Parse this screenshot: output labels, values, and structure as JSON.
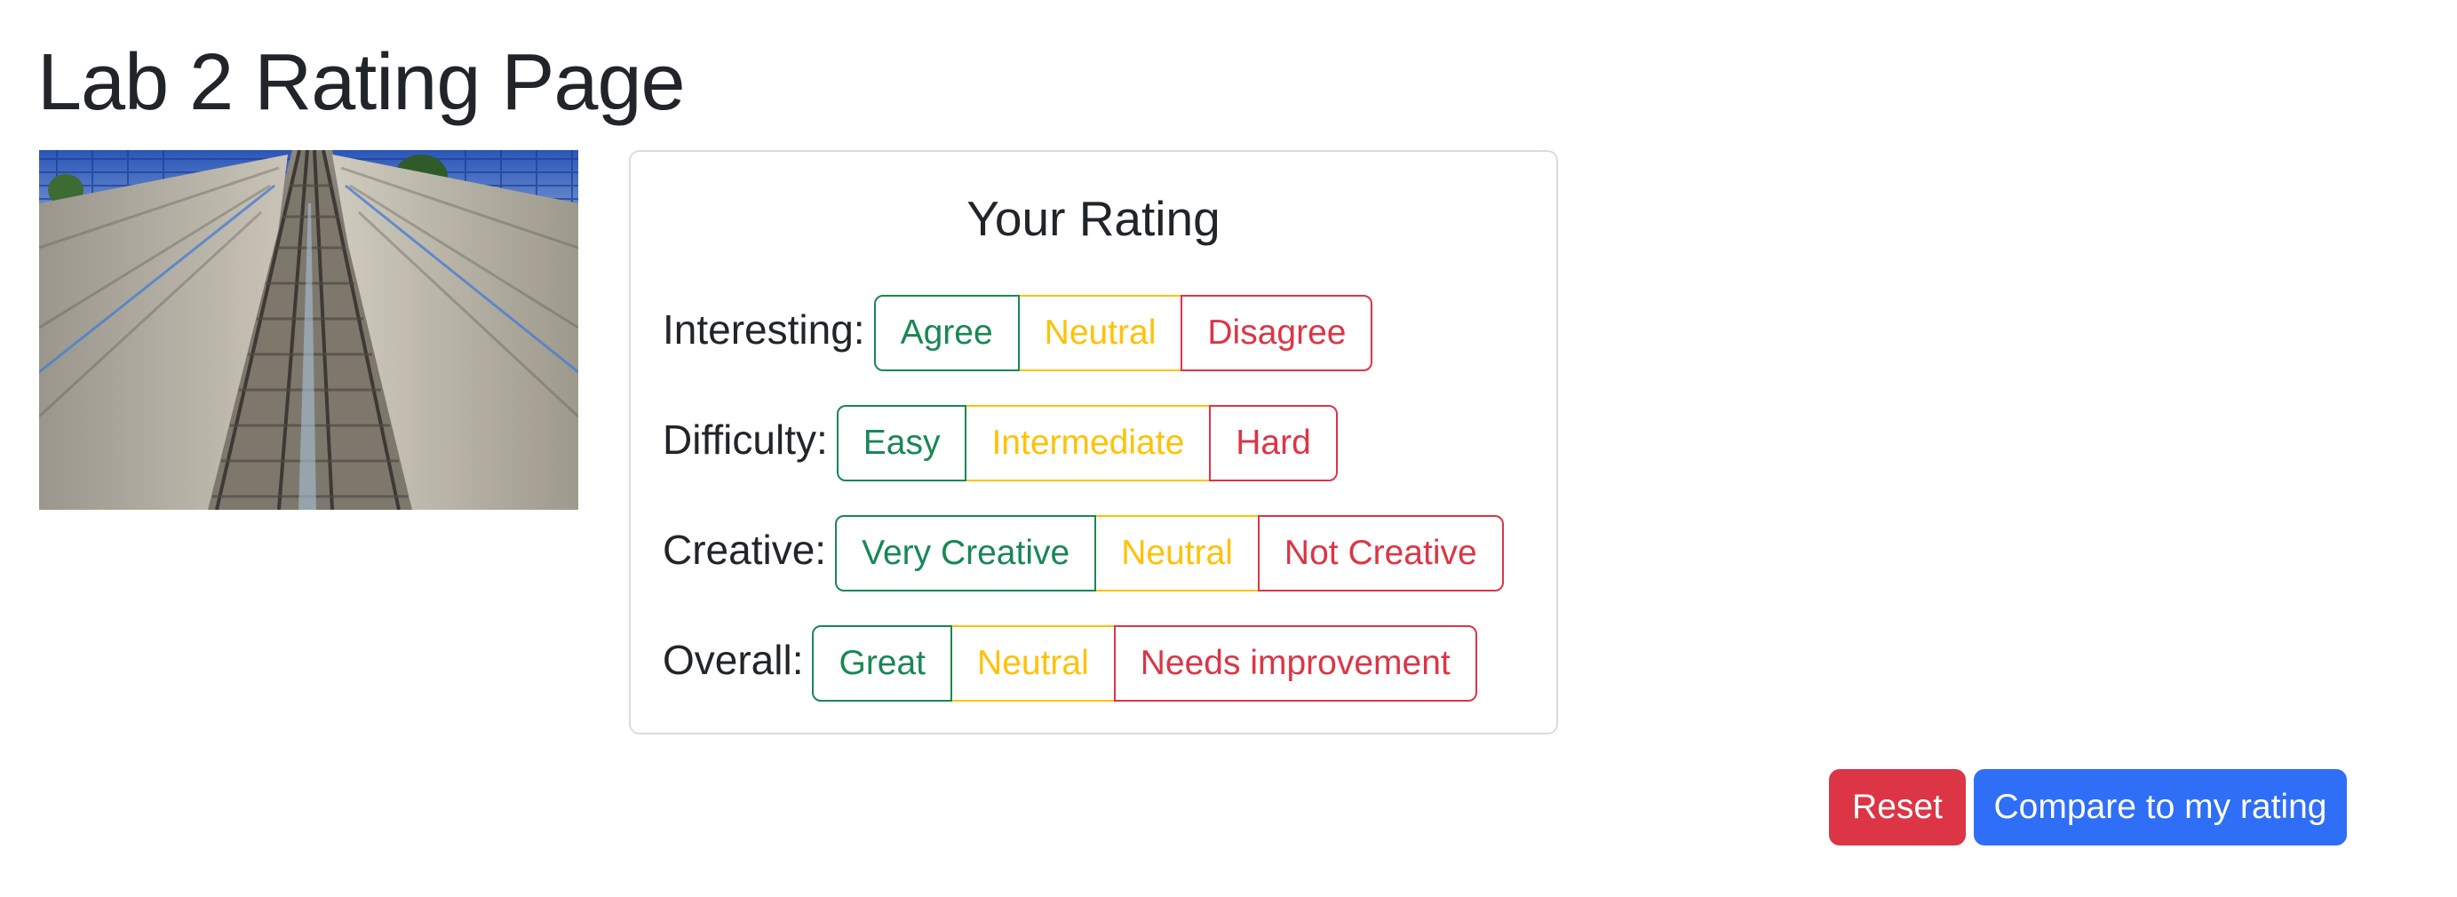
{
  "page": {
    "title": "Lab 2 Rating Page"
  },
  "photo": {
    "subject": "railway-tracks-photo"
  },
  "rating_card": {
    "title": "Your Rating",
    "rows": [
      {
        "label": "Interesting:",
        "options": [
          "Agree",
          "Neutral",
          "Disagree"
        ]
      },
      {
        "label": "Difficulty:",
        "options": [
          "Easy",
          "Intermediate",
          "Hard"
        ]
      },
      {
        "label": "Creative:",
        "options": [
          "Very Creative",
          "Neutral",
          "Not Creative"
        ]
      },
      {
        "label": "Overall:",
        "options": [
          "Great",
          "Neutral",
          "Needs improvement"
        ]
      }
    ]
  },
  "actions": {
    "reset_label": "Reset",
    "compare_label": "Compare to my rating"
  },
  "colors": {
    "positive": "#198754",
    "neutral": "#ffc107",
    "negative": "#dc3545",
    "primary": "#2f6ef7"
  }
}
